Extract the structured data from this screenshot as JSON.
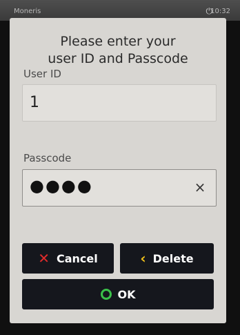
{
  "status_bar": {
    "brand": "Moneris",
    "time": "10:32"
  },
  "prompt": {
    "line1": "Please enter your",
    "line2": "user ID and Passcode"
  },
  "user_id": {
    "label": "User ID",
    "value": "1"
  },
  "passcode": {
    "label": "Passcode",
    "masked_value": "●●●●",
    "clear_icon": "×"
  },
  "buttons": {
    "cancel": "Cancel",
    "delete": "Delete",
    "ok": "OK"
  },
  "icons": {
    "cancel": "close-x-icon",
    "delete": "chevron-left-icon",
    "ok": "circle-icon",
    "power": "plug-icon"
  },
  "colors": {
    "cancel_icon": "#e02b2b",
    "delete_icon": "#f2c21a",
    "ok_icon": "#3bc14a",
    "button_bg": "#15171d"
  }
}
